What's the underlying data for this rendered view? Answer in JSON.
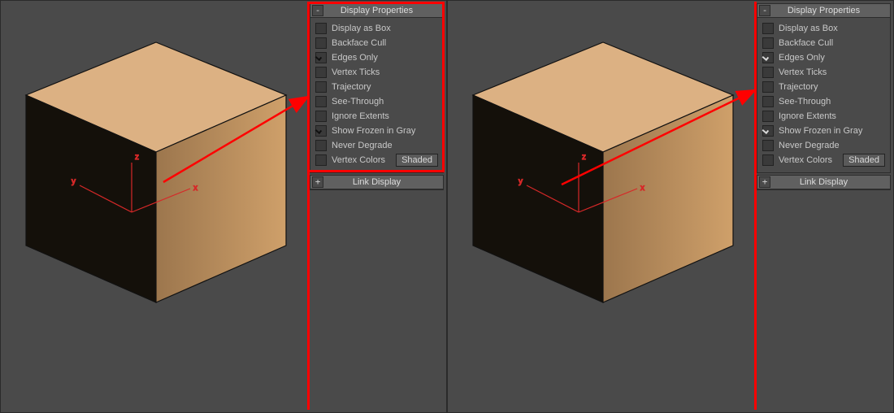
{
  "panels": {
    "displayProperties": {
      "title": "Display Properties",
      "toggle": "-",
      "items": [
        {
          "key": "display_as_box",
          "label": "Display as Box",
          "checked": false
        },
        {
          "key": "backface_cull",
          "label": "Backface Cull",
          "checked": false
        },
        {
          "key": "edges_only",
          "label": "Edges Only",
          "checked": true
        },
        {
          "key": "vertex_ticks",
          "label": "Vertex Ticks",
          "checked": false
        },
        {
          "key": "trajectory",
          "label": "Trajectory",
          "checked": false
        },
        {
          "key": "see_through",
          "label": "See-Through",
          "checked": false
        },
        {
          "key": "ignore_extents",
          "label": "Ignore Extents",
          "checked": false
        },
        {
          "key": "show_frozen_gray",
          "label": "Show Frozen in Gray",
          "checked": true
        },
        {
          "key": "never_degrade",
          "label": "Never Degrade",
          "checked": false
        },
        {
          "key": "vertex_colors",
          "label": "Vertex Colors",
          "checked": false,
          "button": "Shaded"
        }
      ]
    },
    "linkDisplay": {
      "title": "Link Display",
      "toggle": "+"
    }
  },
  "axes": {
    "x": "x",
    "y": "y",
    "z": "z"
  },
  "variants": {
    "left": {
      "checkStyle": "dark",
      "highlightPanel": true
    },
    "right": {
      "checkStyle": "light",
      "highlightPanel": false
    }
  }
}
